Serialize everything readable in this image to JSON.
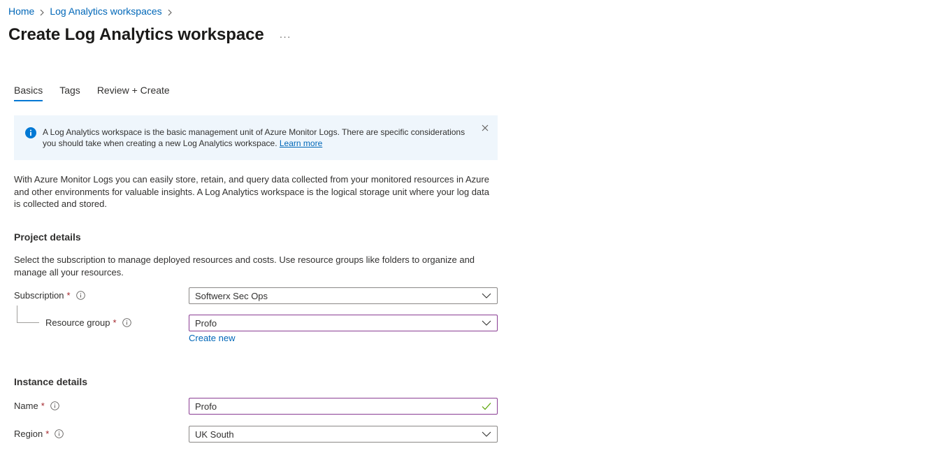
{
  "breadcrumb": {
    "items": [
      {
        "label": "Home"
      },
      {
        "label": "Log Analytics workspaces"
      }
    ]
  },
  "header": {
    "title": "Create Log Analytics workspace",
    "more_label": "···"
  },
  "tabs": [
    {
      "label": "Basics",
      "active": true
    },
    {
      "label": "Tags",
      "active": false
    },
    {
      "label": "Review + Create",
      "active": false
    }
  ],
  "banner": {
    "text": "A Log Analytics workspace is the basic management unit of Azure Monitor Logs. There are specific considerations you should take when creating a new Log Analytics workspace.",
    "link": "Learn more"
  },
  "intro": "With Azure Monitor Logs you can easily store, retain, and query data collected from your monitored resources in Azure and other environments for valuable insights. A Log Analytics workspace is the logical storage unit where your log data is collected and stored.",
  "project": {
    "title": "Project details",
    "description": "Select the subscription to manage deployed resources and costs. Use resource groups like folders to organize and manage all your resources.",
    "subscription": {
      "label": "Subscription",
      "required": "*",
      "value": "Softwerx Sec Ops"
    },
    "resource_group": {
      "label": "Resource group",
      "required": "*",
      "value": "Profo",
      "create_new": "Create new"
    }
  },
  "instance": {
    "title": "Instance details",
    "name": {
      "label": "Name",
      "required": "*",
      "value": "Profo"
    },
    "region": {
      "label": "Region",
      "required": "*",
      "value": "UK South"
    }
  },
  "colors": {
    "accent": "#0078d4",
    "link": "#0067b8",
    "focus_border": "#8a3d93",
    "required": "#a4262c",
    "valid_check": "#57a300",
    "banner_bg": "#eff6fc"
  }
}
